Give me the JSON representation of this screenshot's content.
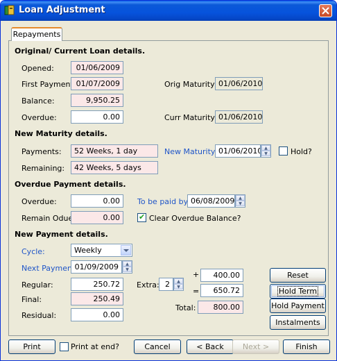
{
  "window": {
    "title": "Loan Adjustment"
  },
  "tab": {
    "label": "Repayments"
  },
  "original": {
    "heading": "Original/ Current Loan details.",
    "opened_label": "Opened:",
    "opened": "01/06/2009",
    "first_payment_label": "First Payment:",
    "first_payment": "01/07/2009",
    "balance_label": "Balance:",
    "balance": "9,950.25",
    "overdue_label": "Overdue:",
    "overdue": "0.00",
    "orig_maturity_label": "Orig Maturity:",
    "orig_maturity": "01/06/2010",
    "curr_maturity_label": "Curr Maturity:",
    "curr_maturity": "01/06/2010"
  },
  "new_maturity": {
    "heading": "New Maturity details.",
    "payments_label": "Payments:",
    "payments": "52 Weeks, 1 day",
    "remaining_label": "Remaining:",
    "remaining": "42 Weeks, 5 days",
    "new_maturity_label": "New Maturity:",
    "new_maturity": "01/06/2010",
    "hold_label": "Hold?",
    "hold_checked": false
  },
  "overdue_payment": {
    "heading": "Overdue Payment details.",
    "overdue_label": "Overdue:",
    "overdue": "0.00",
    "remain_label": "Remain Odue:",
    "remain": "0.00",
    "paid_by_label": "To be paid by:",
    "paid_by": "06/08/2009",
    "clear_label": "Clear Overdue Balance?",
    "clear_checked": true
  },
  "new_payment": {
    "heading": "New Payment details.",
    "cycle_label": "Cycle:",
    "cycle": "Weekly",
    "next_payment_label": "Next Payment:",
    "next_payment": "01/09/2009",
    "regular_label": "Regular:",
    "regular": "250.72",
    "final_label": "Final:",
    "final": "250.49",
    "residual_label": "Residual:",
    "residual": "0.00",
    "extra_label": "Extra:",
    "extra": "2",
    "plus": "+",
    "equals": "=",
    "extra_amount": "400.00",
    "sum": "650.72",
    "total_label": "Total:",
    "total": "800.00"
  },
  "side_buttons": {
    "reset": "Reset",
    "hold_term": "Hold Term",
    "hold_payment": "Hold Payment",
    "instalments": "Instalments"
  },
  "footer": {
    "print": "Print",
    "print_at_end": "Print at end?",
    "print_at_end_checked": false,
    "cancel": "Cancel",
    "back": "< Back",
    "next": "Next >",
    "finish": "Finish"
  },
  "colors": {
    "title_bar": "#0653dc",
    "link": "#1f55c8",
    "readonly_pink": "#fbe8e8",
    "close": "#c84a26"
  }
}
